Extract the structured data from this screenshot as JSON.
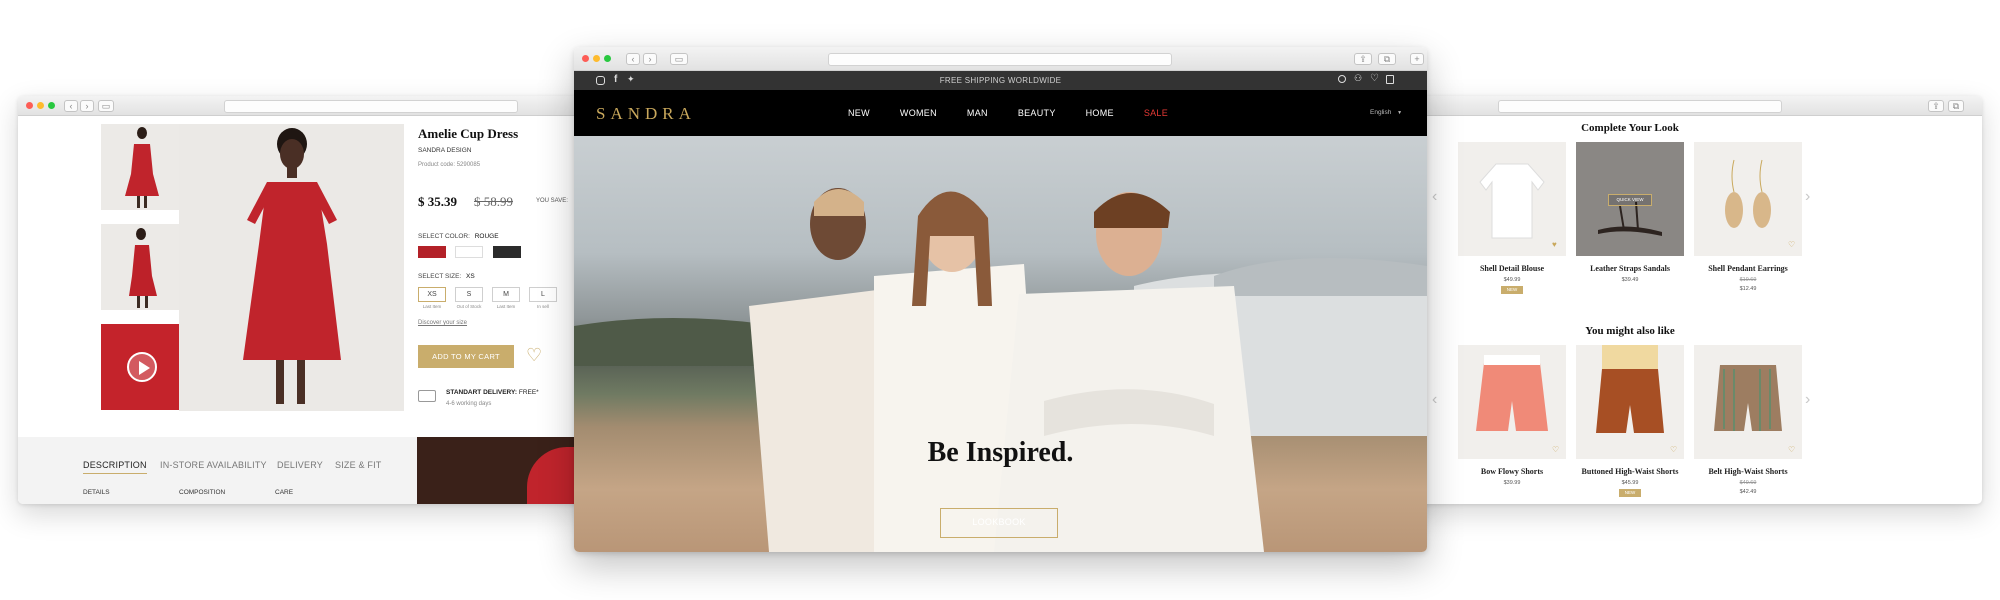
{
  "product_window": {
    "title": "Amelie Cup Dress",
    "brand": "SANDRA DESIGN",
    "product_code": "Product code: 5290085",
    "price": "$ 35.39",
    "old_price": "$ 58.99",
    "you_save": "YOU SAVE:",
    "select_color_label": "SELECT COLOR:",
    "select_color_value": "ROUGE",
    "colors": [
      "#b32128",
      "#ffffff",
      "#2b2b2b"
    ],
    "select_size_label": "SELECT SIZE:",
    "select_size_value": "XS",
    "sizes": [
      {
        "label": "XS",
        "note": "Last Item"
      },
      {
        "label": "S",
        "note": "Out of Stock"
      },
      {
        "label": "M",
        "note": "Last Item"
      },
      {
        "label": "L",
        "note": "In sell"
      }
    ],
    "discover_size": "Discover your size",
    "add_to_cart": "ADD TO MY CART",
    "delivery_title": "STANDART DELIVERY:",
    "delivery_free": "FREE*",
    "delivery_days": "4-6 working days",
    "tabs": [
      "DESCRIPTION",
      "IN-STORE AVAILABILITY",
      "DELIVERY",
      "SIZE & FIT"
    ],
    "detail_headers": [
      "DETAILS",
      "COMPOSITION",
      "CARE"
    ]
  },
  "main_window": {
    "topbar_text": "FREE SHIPPING WORLDWIDE",
    "logo": "SANDRA",
    "nav": [
      "NEW",
      "WOMEN",
      "MAN",
      "BEAUTY",
      "HOME",
      "SALE"
    ],
    "sale_color": "#e53935",
    "language": "English",
    "hero_headline": "Be Inspired.",
    "hero_button": "LOOKBOOK"
  },
  "right_window": {
    "complete_title": "Complete Your Look",
    "complete_items": [
      {
        "name": "Shell Detail Blouse",
        "price": "$49.99",
        "badge": "NEW"
      },
      {
        "name": "Leather Straps Sandals",
        "price": "$39.49",
        "quick_view": "QUICK VIEW"
      },
      {
        "name": "Shell Pendant Earrings",
        "old_price": "$19.69",
        "price": "$12.49"
      }
    ],
    "also_like_title": "You might also like",
    "also_like_items": [
      {
        "name": "Bow Flowy Shorts",
        "price": "$39.99"
      },
      {
        "name": "Buttoned High-Waist Shorts",
        "price": "$45.99",
        "badge": "NEW"
      },
      {
        "name": "Belt High-Waist Shorts",
        "old_price": "$49.69",
        "price": "$42.49"
      }
    ]
  },
  "accent_gold": "#c9ad6c"
}
